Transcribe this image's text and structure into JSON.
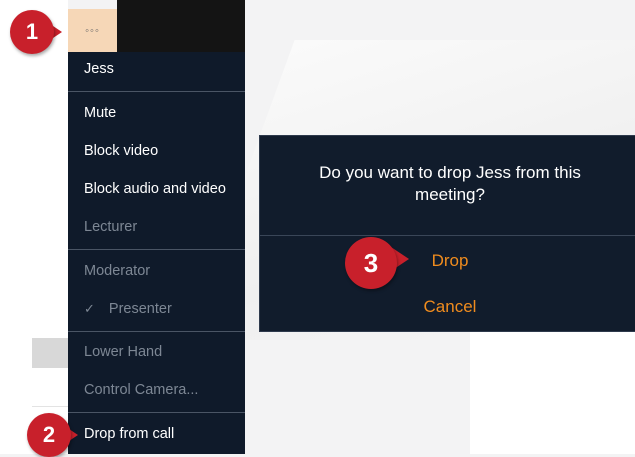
{
  "more_button": {
    "label": "◦◦◦"
  },
  "menu": {
    "header": "Jess",
    "items": [
      {
        "label": "Mute",
        "enabled": true
      },
      {
        "label": "Block video",
        "enabled": true
      },
      {
        "label": "Block audio and video",
        "enabled": true
      },
      {
        "label": "Lecturer",
        "enabled": false
      },
      {
        "label": "Moderator",
        "enabled": false
      },
      {
        "label": "Presenter",
        "enabled": false,
        "checked": true
      },
      {
        "label": "Lower Hand",
        "enabled": false
      },
      {
        "label": "Control Camera...",
        "enabled": false
      },
      {
        "label": "Drop from call",
        "enabled": true
      }
    ],
    "check_mark": "✓"
  },
  "dialog": {
    "message_line1": "Do you want to drop Jess from this",
    "message_line2": "meeting?",
    "confirm_label": "Drop",
    "cancel_label": "Cancel"
  },
  "callouts": [
    "1",
    "2",
    "3"
  ],
  "colors": {
    "menu_bg": "#0f1a2a",
    "accent_orange": "#f08c1e",
    "callout_red": "#c8202b",
    "more_button_bg": "#f6d7b7"
  }
}
